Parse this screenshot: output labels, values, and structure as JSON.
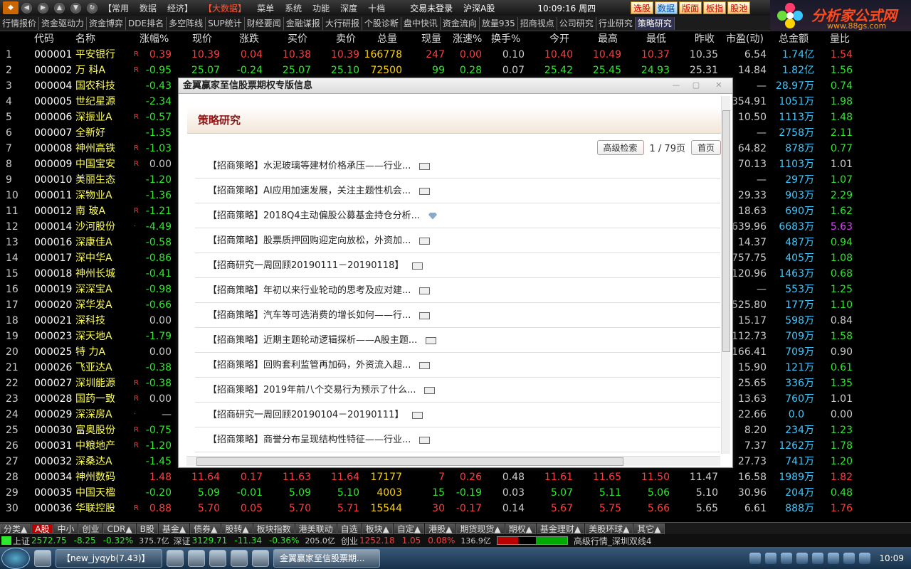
{
  "topbar": {
    "menus": [
      "【常用",
      "数据",
      "经济】",
      "【大数据】",
      "菜单",
      "系统",
      "功能",
      "深度",
      "十档"
    ],
    "title": "交易未登录",
    "market": "沪深A股",
    "time": "10:09:16",
    "weekday": "周四",
    "quick_buttons": [
      "选股",
      "数据",
      "版面",
      "板指",
      "股池"
    ],
    "logo_text": "分析家公式网",
    "logo_url": "www.88gs.com"
  },
  "tabs": [
    "行情报价",
    "资金驱动力",
    "资金博弈",
    "DDE排名",
    "多空阵线",
    "SUP统计",
    "财经要闻",
    "金融谋报",
    "大行研报",
    "个股诊断",
    "盘中快讯",
    "资金流向",
    "放量935",
    "招商视点",
    "公司研究",
    "行业研究",
    "策略研究"
  ],
  "active_tab": "策略研究",
  "columns": [
    "代码",
    "名称",
    "涨幅%",
    "现价",
    "涨跌",
    "买价",
    "卖价",
    "总量",
    "现量",
    "涨速%",
    "换手%",
    "今开",
    "最高",
    "最低",
    "昨收",
    "市盈(动)",
    "总金额",
    "量比"
  ],
  "rows": [
    {
      "i": "1",
      "code": "000001",
      "name": "平安银行",
      "r": "R",
      "chg": "0.39",
      "price": "10.39",
      "diff": "0.04",
      "bid": "10.38",
      "ask": "10.39",
      "vol": "166778",
      "cur": "247",
      "spd": "0.00",
      "turn": "0.10",
      "open": "10.40",
      "high": "10.49",
      "low": "10.37",
      "prev": "10.35",
      "pe": "6.54",
      "amt": "1.74",
      "unit": "亿",
      "qr": "1.54",
      "d": "up"
    },
    {
      "i": "2",
      "code": "000002",
      "name": "万 科A",
      "r": "R",
      "chg": "-0.95",
      "price": "25.07",
      "diff": "-0.24",
      "bid": "25.07",
      "ask": "25.10",
      "vol": "72500",
      "cur": "99",
      "spd": "0.28",
      "turn": "0.07",
      "open": "25.42",
      "high": "25.45",
      "low": "24.93",
      "prev": "25.31",
      "pe": "14.84",
      "amt": "1.82",
      "unit": "亿",
      "qr": "1.56",
      "d": "dn"
    },
    {
      "i": "3",
      "code": "000004",
      "name": "国农科技",
      "r": "",
      "chg": "-0.43",
      "pe": "—",
      "amt": "28.97",
      "unit": "万",
      "qr": "0.74",
      "d": "dn"
    },
    {
      "i": "4",
      "code": "000005",
      "name": "世纪星源",
      "r": "",
      "chg": "-2.34",
      "pe": "354.91",
      "amt": "1051",
      "unit": "万",
      "qr": "1.98",
      "d": "dn"
    },
    {
      "i": "5",
      "code": "000006",
      "name": "深振业A",
      "r": "R",
      "chg": "-0.57",
      "pe": "10.50",
      "amt": "1113",
      "unit": "万",
      "qr": "1.48",
      "d": "dn"
    },
    {
      "i": "6",
      "code": "000007",
      "name": "全新好",
      "r": "",
      "chg": "-1.35",
      "pe": "—",
      "amt": "2758",
      "unit": "万",
      "qr": "2.11",
      "d": "dn"
    },
    {
      "i": "7",
      "code": "000008",
      "name": "神州高铁",
      "r": "R",
      "chg": "-1.03",
      "pe": "64.82",
      "amt": "878",
      "unit": "万",
      "qr": "0.77",
      "d": "dn"
    },
    {
      "i": "8",
      "code": "000009",
      "name": "中国宝安",
      "r": "R",
      "chg": "0.00",
      "pe": "70.13",
      "amt": "1103",
      "unit": "万",
      "qr": "1.01",
      "d": "fl"
    },
    {
      "i": "9",
      "code": "000010",
      "name": "美丽生态",
      "r": "",
      "chg": "-1.20",
      "pe": "—",
      "amt": "297",
      "unit": "万",
      "qr": "1.07",
      "d": "dn"
    },
    {
      "i": "10",
      "code": "000011",
      "name": "深物业A",
      "r": "",
      "chg": "-1.36",
      "pe": "29.33",
      "amt": "903",
      "unit": "万",
      "qr": "2.29",
      "d": "dn"
    },
    {
      "i": "11",
      "code": "000012",
      "name": "南 玻A",
      "r": "R",
      "chg": "-1.21",
      "pe": "18.63",
      "amt": "690",
      "unit": "万",
      "qr": "1.62",
      "d": "dn"
    },
    {
      "i": "12",
      "code": "000014",
      "name": "沙河股份",
      "r": "·",
      "chg": "-4.49",
      "pe": "639.96",
      "amt": "6683",
      "unit": "万",
      "qr": "5.63",
      "d": "dn",
      "qrmag": true
    },
    {
      "i": "13",
      "code": "000016",
      "name": "深康佳A",
      "r": "",
      "chg": "-0.58",
      "pe": "14.37",
      "amt": "487",
      "unit": "万",
      "qr": "0.94",
      "d": "dn"
    },
    {
      "i": "14",
      "code": "000017",
      "name": "深中华A",
      "r": "",
      "chg": "-0.86",
      "pe": "757.75",
      "amt": "405",
      "unit": "万",
      "qr": "1.08",
      "d": "dn"
    },
    {
      "i": "15",
      "code": "000018",
      "name": "神州长城",
      "r": "",
      "chg": "-0.41",
      "pe": "120.96",
      "amt": "1463",
      "unit": "万",
      "qr": "0.68",
      "d": "dn"
    },
    {
      "i": "16",
      "code": "000019",
      "name": "深深宝A",
      "r": "",
      "chg": "-0.98",
      "pe": "—",
      "amt": "553",
      "unit": "万",
      "qr": "1.25",
      "d": "dn"
    },
    {
      "i": "17",
      "code": "000020",
      "name": "深华发A",
      "r": "",
      "chg": "-0.66",
      "pe": "1525.80",
      "amt": "177",
      "unit": "万",
      "qr": "1.10",
      "d": "dn"
    },
    {
      "i": "18",
      "code": "000021",
      "name": "深科技",
      "r": "",
      "chg": "0.00",
      "pe": "15.17",
      "amt": "598",
      "unit": "万",
      "qr": "0.84",
      "d": "fl"
    },
    {
      "i": "19",
      "code": "000023",
      "name": "深天地A",
      "r": "",
      "chg": "-1.79",
      "pe": "112.73",
      "amt": "709",
      "unit": "万",
      "qr": "1.58",
      "d": "dn"
    },
    {
      "i": "20",
      "code": "000025",
      "name": "特 力A",
      "r": "",
      "chg": "0.00",
      "pe": "166.41",
      "amt": "709",
      "unit": "万",
      "qr": "0.90",
      "d": "fl"
    },
    {
      "i": "21",
      "code": "000026",
      "name": "飞亚达A",
      "r": "",
      "chg": "-0.38",
      "pe": "15.90",
      "amt": "121",
      "unit": "万",
      "qr": "0.61",
      "d": "dn"
    },
    {
      "i": "22",
      "code": "000027",
      "name": "深圳能源",
      "r": "R",
      "chg": "-0.38",
      "pe": "25.65",
      "amt": "336",
      "unit": "万",
      "qr": "1.35",
      "d": "dn"
    },
    {
      "i": "23",
      "code": "000028",
      "name": "国药一致",
      "r": "R",
      "chg": "0.00",
      "pe": "13.63",
      "amt": "760",
      "unit": "万",
      "qr": "1.01",
      "d": "fl"
    },
    {
      "i": "24",
      "code": "000029",
      "name": "深深房A",
      "r": "·",
      "chg": "—",
      "pe": "22.66",
      "amt": "0.0",
      "unit": "",
      "qr": "0.00",
      "d": "fl"
    },
    {
      "i": "25",
      "code": "000030",
      "name": "富奥股份",
      "r": "R",
      "chg": "-0.75",
      "pe": "8.20",
      "amt": "234",
      "unit": "万",
      "qr": "1.23",
      "d": "dn"
    },
    {
      "i": "26",
      "code": "000031",
      "name": "中粮地产",
      "r": "R",
      "chg": "-1.20",
      "pe": "7.37",
      "amt": "1262",
      "unit": "万",
      "qr": "1.78",
      "d": "dn"
    },
    {
      "i": "27",
      "code": "000032",
      "name": "深桑达A",
      "r": "",
      "chg": "-1.45",
      "pe": "27.73",
      "amt": "741",
      "unit": "万",
      "qr": "1.20",
      "d": "dn"
    },
    {
      "i": "28",
      "code": "000034",
      "name": "神州数码",
      "r": "",
      "chg": "1.48",
      "price": "11.64",
      "diff": "0.17",
      "bid": "11.63",
      "ask": "11.64",
      "vol": "17177",
      "cur": "7",
      "spd": "0.26",
      "turn": "0.48",
      "open": "11.61",
      "high": "11.65",
      "low": "11.50",
      "prev": "11.47",
      "pe": "16.58",
      "amt": "1989",
      "unit": "万",
      "qr": "1.82",
      "d": "up"
    },
    {
      "i": "29",
      "code": "000035",
      "name": "中国天楹",
      "r": "",
      "chg": "-0.20",
      "price": "5.09",
      "diff": "-0.01",
      "bid": "5.09",
      "ask": "5.10",
      "vol": "4003",
      "cur": "15",
      "spd": "-0.19",
      "turn": "0.03",
      "open": "5.07",
      "high": "5.11",
      "low": "5.06",
      "prev": "5.10",
      "pe": "30.96",
      "amt": "204",
      "unit": "万",
      "qr": "0.48",
      "d": "dn"
    },
    {
      "i": "30",
      "code": "000036",
      "name": "华联控股",
      "r": "R",
      "chg": "0.88",
      "price": "5.70",
      "diff": "0.05",
      "bid": "5.70",
      "ask": "5.71",
      "vol": "15544",
      "cur": "30",
      "spd": "-0.17",
      "turn": "0.14",
      "open": "5.67",
      "high": "5.75",
      "low": "5.66",
      "prev": "5.65",
      "pe": "6.61",
      "amt": "888",
      "unit": "万",
      "qr": "1.76",
      "d": "up"
    }
  ],
  "bottom_tabs": [
    "分类▲",
    "A股",
    "中小",
    "创业",
    "CDR▲",
    "B股",
    "基金▲",
    "债券▲",
    "股转▲",
    "板块指数",
    "港美联动",
    "自选",
    "板块▲",
    "自定▲",
    "港股▲",
    "期货现货▲",
    "期权▲",
    "基金理财▲",
    "美股环球▲",
    "其它▲"
  ],
  "active_bottom_tab": "A股",
  "status": {
    "sh_label": "上证",
    "sh_val": "2572.75",
    "sh_diff": "-8.25",
    "sh_pct": "-0.32%",
    "sh_amt": "375.7亿",
    "sz_label": "深证",
    "sz_val": "3129.71",
    "sz_diff": "-11.34",
    "sz_pct": "-0.36%",
    "sz_amt": "205.0亿",
    "cy_label": "创业",
    "cy_val": "1252.18",
    "cy_diff": "1.05",
    "cy_pct": "0.08%",
    "cy_amt": "136.9亿",
    "server": "高级行情_深圳双线4"
  },
  "taskbar": {
    "items": [
      "【new_jyqyb(7.43)】",
      "金翼赢家至信股票期..."
    ],
    "time": "10:09"
  },
  "dialog": {
    "title": "金翼赢家至信股票期权专版信息",
    "section": "策略研究",
    "search_btn": "高级检索",
    "page_info": "1 / 79页",
    "first_btn": "首页",
    "items": [
      {
        "text": "【招商策略】水泥玻璃等建材价格承压——行业...",
        "icon": "doc"
      },
      {
        "text": "【招商策略】AI应用加速发展，关注主题性机会...",
        "icon": "doc"
      },
      {
        "text": "【招商策略】2018Q4主动偏股公募基金持仓分析...",
        "icon": "gem"
      },
      {
        "text": "【招商策略】股票质押回购迎定向放松，外资加...",
        "icon": "doc"
      },
      {
        "text": "【招商研究一周回顾20190111－20190118】",
        "icon": "doc"
      },
      {
        "text": "【招商策略】年初以来行业轮动的思考及应对建...",
        "icon": "doc"
      },
      {
        "text": "【招商策略】汽车等可选消费的增长如何——行...",
        "icon": "doc"
      },
      {
        "text": "【招商策略】近期主题轮动逻辑探析——A股主题...",
        "icon": "doc"
      },
      {
        "text": "【招商策略】回购套利监管再加码，外资流入超...",
        "icon": "doc"
      },
      {
        "text": "【招商策略】2019年前八个交易行为预示了什么...",
        "icon": "doc"
      },
      {
        "text": "【招商研究一周回顾20190104－20190111】",
        "icon": "doc"
      },
      {
        "text": "【招商策略】商誉分布呈现结构性特征——行业...",
        "icon": "doc"
      }
    ]
  }
}
